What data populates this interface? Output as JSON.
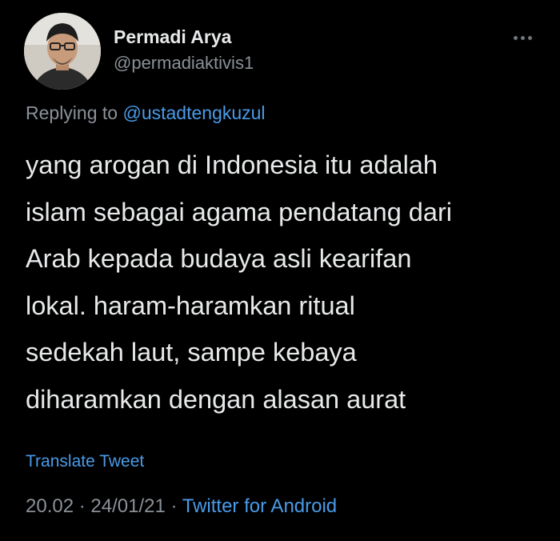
{
  "author": {
    "display_name": "Permadi Arya",
    "handle": "@permadiaktivis1"
  },
  "reply_context": {
    "prefix": "Replying to",
    "mention": "@ustadtengkuzul"
  },
  "tweet": {
    "lines": [
      "yang arogan di Indonesia itu adalah",
      "islam sebagai agama pendatang dari",
      "Arab kepada budaya asli kearifan",
      "lokal. haram-haramkan ritual",
      "sedekah laut, sampe kebaya",
      "diharamkan dengan alasan aurat"
    ]
  },
  "actions": {
    "translate_label": "Translate Tweet"
  },
  "meta": {
    "time": "20.02",
    "separator": "·",
    "date": "24/01/21",
    "source": "Twitter for Android"
  },
  "icons": {
    "more": "more-horizontal-icon",
    "avatar": "avatar"
  },
  "colors": {
    "background": "#000000",
    "text": "#e7e9ea",
    "secondary": "#8b9198",
    "link": "#4a9be8"
  }
}
